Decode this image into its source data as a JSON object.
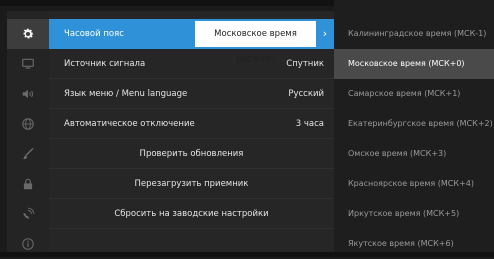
{
  "settings": {
    "rows": [
      {
        "label": "Часовой пояс",
        "value": "Московское время (МСК+0)"
      },
      {
        "label": "Источник сигнала",
        "value": "Спутник"
      },
      {
        "label": "Язык меню / Menu language",
        "value": "Русский"
      },
      {
        "label": "Автоматическое отключение",
        "value": "3 часа"
      },
      {
        "label": "Проверить обновления"
      },
      {
        "label": "Перезагрузить приемник"
      },
      {
        "label": "Сбросить на заводские настройки"
      }
    ]
  },
  "timezone_dropdown": {
    "selected_index": 1,
    "options": [
      "Калининградское время (МСК-1)",
      "Московское время (МСК+0)",
      "Самарское время (МСК+1)",
      "Екатеринбургское время (МСК+2)",
      "Омское время (МСК+3)",
      "Красноярское время (МСК+4)",
      "Иркутское время (МСК+5)",
      "Якутское время (МСК+6)"
    ]
  },
  "sidebar": {
    "icons": [
      "gear-icon",
      "monitor-icon",
      "speaker-icon",
      "globe-icon",
      "brush-icon",
      "lock-icon",
      "satellite-icon",
      "info-icon"
    ],
    "active_index": 0
  },
  "colors": {
    "accent": "#2f92d8",
    "selected_option": "#4a4a4a",
    "background": "#1b1b1b"
  }
}
